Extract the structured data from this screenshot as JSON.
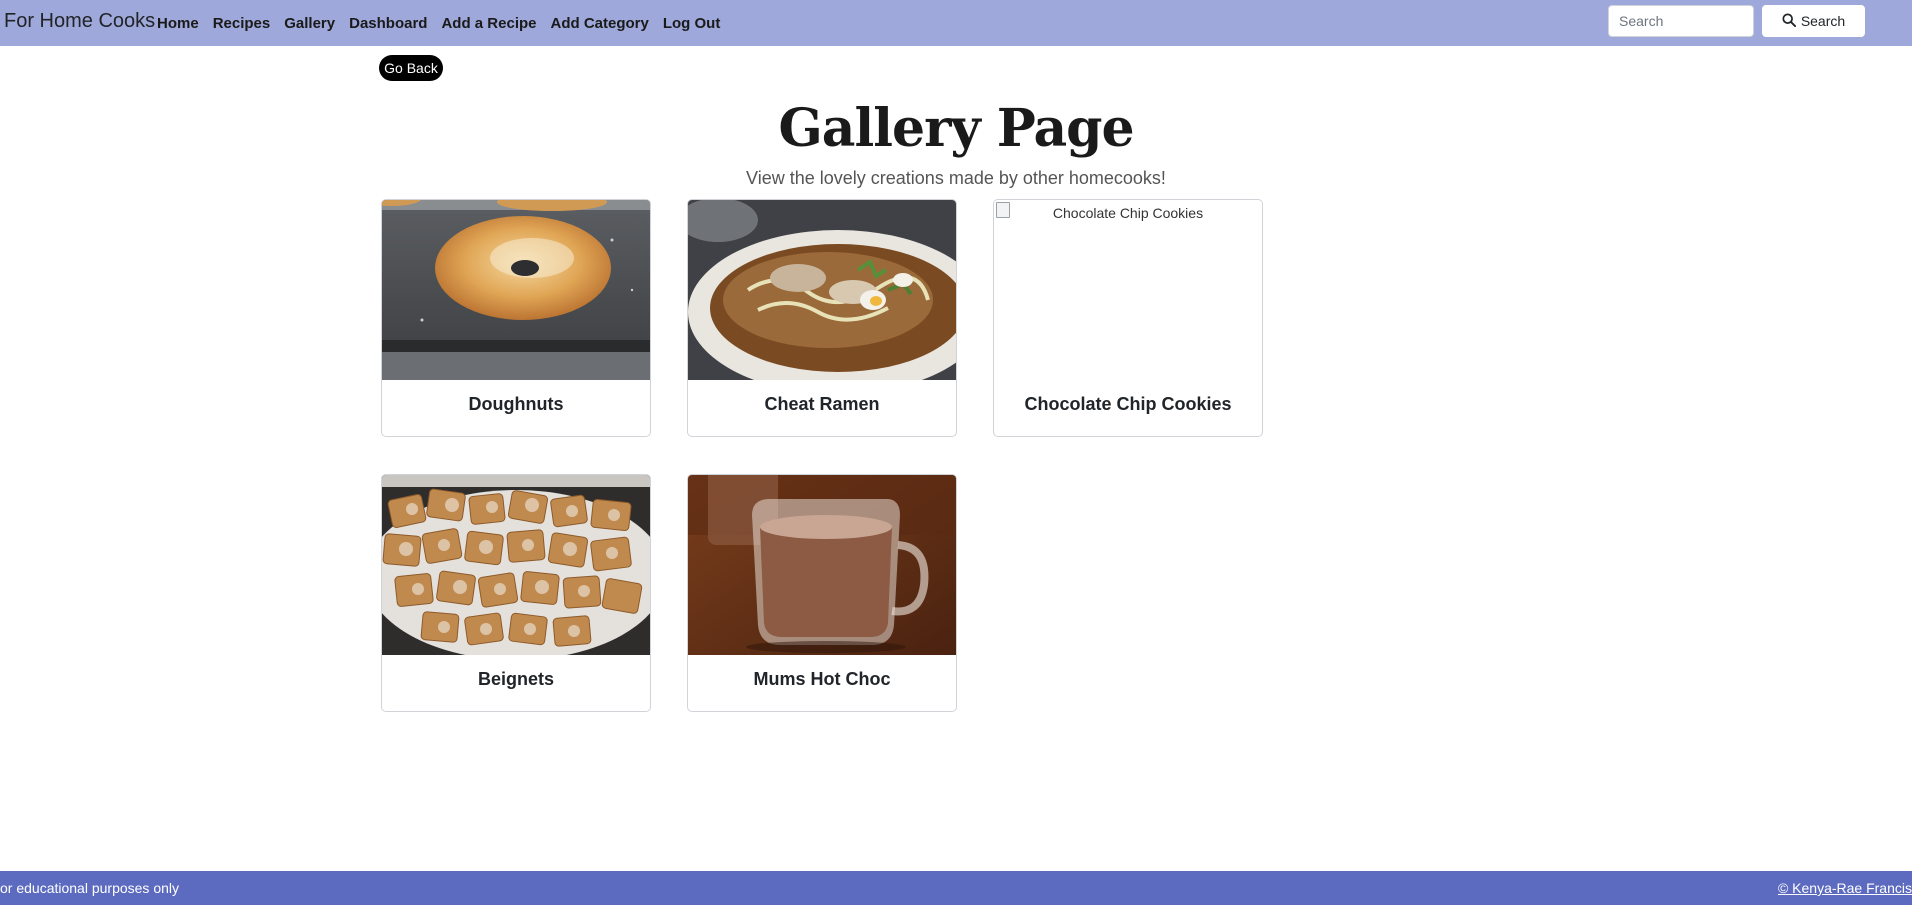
{
  "navbar": {
    "brand": "For Home Cooks",
    "links": [
      {
        "label": "Home"
      },
      {
        "label": "Recipes"
      },
      {
        "label": "Gallery"
      },
      {
        "label": "Dashboard"
      },
      {
        "label": "Add a Recipe"
      },
      {
        "label": "Add Category"
      },
      {
        "label": "Log Out"
      }
    ],
    "search": {
      "placeholder": "Search",
      "value": "",
      "button_label": "Search",
      "button_icon": "search-icon"
    },
    "background_color": "#9fa8da"
  },
  "go_back": {
    "label": "Go Back"
  },
  "header": {
    "title": "Gallery Page",
    "subtitle": "View the lovely creations made by other homecooks!"
  },
  "gallery": {
    "items": [
      {
        "title": "Doughnuts",
        "image": "doughnut-photo"
      },
      {
        "title": "Cheat Ramen",
        "image": "ramen-photo"
      },
      {
        "title": "Chocolate Chip Cookies",
        "image": "broken-image",
        "alt": "Chocolate Chip Cookies"
      },
      {
        "title": "Beignets",
        "image": "beignets-photo"
      },
      {
        "title": "Mums Hot Choc",
        "image": "hot-chocolate-photo"
      }
    ]
  },
  "footer": {
    "left_text": "or educational purposes only",
    "right_text": "© Kenya-Rae Francis",
    "background_color": "#5c6bc0"
  }
}
